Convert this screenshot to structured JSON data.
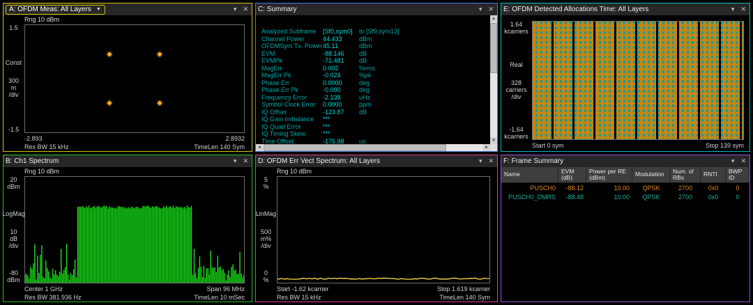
{
  "colors": {
    "panel_a_border": "#d9c400",
    "panel_b_border": "#21c421",
    "panel_c_border": "#4a7ce8",
    "panel_d_border": "#e23f9e",
    "panel_e_border": "#00bdbd",
    "panel_f_border": "#9a4fd9",
    "trace_green": "#17e617",
    "trace_yellow": "#ffe24a",
    "const_orange": "#ffaa2a",
    "alloc_orange": "#c8860e",
    "alloc_teal": "#0f9e9e",
    "summary_label": "#00a8a8",
    "summary_value": "#00dcdc"
  },
  "titlebar": {
    "minimize_icon": "▾",
    "close_icon": "✕"
  },
  "panel_a": {
    "title": "A: OFDM Meas: All Layers",
    "range_label": "Rng 10 dBm",
    "y_max": "1.5",
    "y_name": "Const",
    "y_div": "300\nm\n/div",
    "y_min": "-1.5",
    "x_left": "-2.893",
    "x_right": "2.8932",
    "footer_left": "Res BW 15 kHz",
    "footer_right": "TimeLen 140 Sym",
    "points": [
      {
        "x": 0.385,
        "y": 0.27
      },
      {
        "x": 0.615,
        "y": 0.27
      },
      {
        "x": 0.385,
        "y": 0.73
      },
      {
        "x": 0.615,
        "y": 0.73
      }
    ]
  },
  "panel_b": {
    "title": "B: Ch1 Spectrum",
    "range_label": "Rng 10 dBm",
    "y_max": "20\ndBm",
    "y_name": "LogMag",
    "y_div": "10\ndB\n/div",
    "y_min": "-80\ndBm",
    "x_left": "Center 1 GHz",
    "x_right": "Span 96 MHz",
    "footer_left": "Res BW 381.936  Hz",
    "footer_right": "TimeLen 10  mSec",
    "trace": {
      "band_start": 0.235,
      "band_end": 0.765,
      "band_top": 0.27,
      "noise_top": 0.84
    }
  },
  "panel_c": {
    "title": "C: Summary",
    "lines": [
      {
        "label": "Analyzed  Subframe",
        "value": "[Sf0,sym0]",
        "unit": "to  [Sf9,sym13]"
      },
      {
        "label": "Channel  Power",
        "value": "44.433",
        "unit": "dBm"
      },
      {
        "label": "OFDMSym  Tx.  Power",
        "value": "45.11",
        "unit": "dBm"
      },
      {
        "label": "EVM",
        "value": "-88.146",
        "unit": "dB"
      },
      {
        "label": "EVMPk",
        "value": "-71.481",
        "unit": "dB"
      },
      {
        "label": "MagErr",
        "value": "0.002",
        "unit": "%rms"
      },
      {
        "label": "MagErr  Pk",
        "value": "-0.024",
        "unit": "%pk"
      },
      {
        "label": "Phase  Err",
        "value": "0.0000",
        "unit": "deg"
      },
      {
        "label": "Phase  Err  Pk",
        "value": "-0.000",
        "unit": "deg"
      },
      {
        "label": "Frequency  Error",
        "value": "-2.138",
        "unit": "uHz"
      },
      {
        "label": "Symbol  Clock  Error",
        "value": "0.0000",
        "unit": "ppm"
      },
      {
        "label": "IQ  Offset",
        "value": "-123.87",
        "unit": "dB"
      },
      {
        "label": "IQ  Gain  Imbalance",
        "value": "***",
        "unit": ""
      },
      {
        "label": "IQ  Quad  Error",
        "value": "***",
        "unit": ""
      },
      {
        "label": "IQ  Timing  Skew",
        "value": "***",
        "unit": ""
      },
      {
        "label": "Time  Offset",
        "value": "-175.98",
        "unit": "us"
      }
    ]
  },
  "panel_d": {
    "title": "D: OFDM Err Vect Spectrum: All Layers",
    "range_label": "Rng 10 dBm",
    "y_max": "5\n%",
    "y_name": "LinMag",
    "y_div": "500\nm%\n/div",
    "y_min": "0\n%",
    "x_left": "Start -1.62 kcarrier",
    "x_right": "Stop 1.619 kcarrier",
    "footer_left": "Res BW 15 kHz",
    "footer_right": "TimeLen 140  Sym",
    "trace": {
      "level": 0.962
    }
  },
  "panel_e": {
    "title": "E: OFDM Detected Allocations Time: All Layers",
    "y_max": "1.64\nkcarriers",
    "y_name": "Real",
    "y_div": "328\ncarriers\n/div",
    "y_min": "-1.64\nkcarriers",
    "x_left": "Start 0  sym",
    "x_right": "Stop 139  sym"
  },
  "panel_f": {
    "title": "F: Frame Summary",
    "columns": [
      {
        "label": "Name",
        "align": "right"
      },
      {
        "label": "EVM\n(dB)",
        "align": "right"
      },
      {
        "label": "Power per RE\n(dBm)",
        "align": "right"
      },
      {
        "label": "Modulation",
        "align": "center"
      },
      {
        "label": "Num. of\nRBs",
        "align": "center"
      },
      {
        "label": "RNTI",
        "align": "center"
      },
      {
        "label": "BWP ID",
        "align": "center"
      }
    ],
    "rows": [
      {
        "cells": [
          "PUSCH0",
          "-88.12",
          "10.00",
          "QPSK",
          "2700",
          "0x0",
          "0"
        ],
        "color": "#e08a1e"
      },
      {
        "cells": [
          "PUSCH0_DMRS",
          "-88.48",
          "10.00",
          "QPSK",
          "2700",
          "0x0",
          "0"
        ],
        "color": "#1eb0a0"
      }
    ]
  }
}
